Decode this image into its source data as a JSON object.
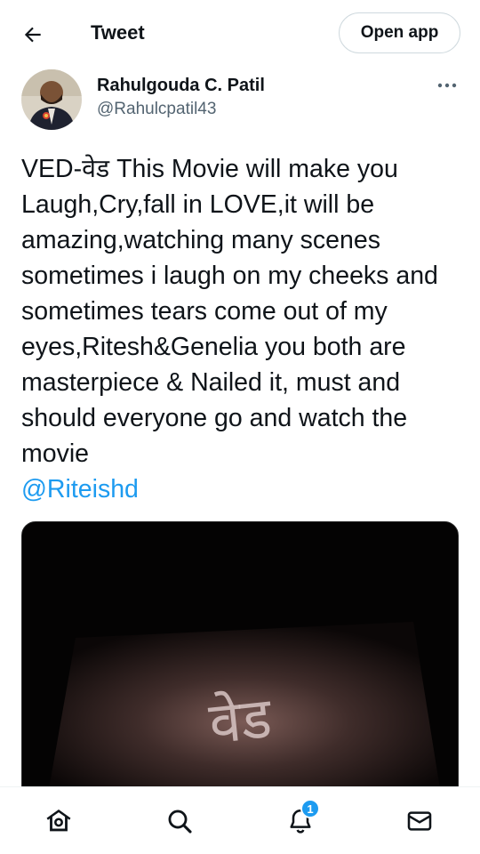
{
  "header": {
    "title": "Tweet",
    "open_app_label": "Open app",
    "back_icon": "arrow-left-icon"
  },
  "tweet": {
    "author": {
      "display_name": "Rahulgouda C. Patil",
      "handle": "@Rahulcpatil43"
    },
    "text": "VED-वेड This Movie will make you Laugh,Cry,fall in LOVE,it will be amazing,watching many scenes sometimes i laugh on my cheeks and sometimes tears come out of my eyes,Ritesh&Genelia you both are masterpiece & Nailed it, must and should everyone go and watch the movie",
    "mention": "@Riteishd",
    "media_title_text": "वेड"
  },
  "bottom_nav": {
    "items": [
      "home-icon",
      "search-icon",
      "notifications-icon",
      "messages-icon"
    ],
    "notification_count": "1"
  },
  "colors": {
    "accent": "#1d9bf0",
    "text_primary": "#0f1419",
    "text_secondary": "#536471"
  }
}
